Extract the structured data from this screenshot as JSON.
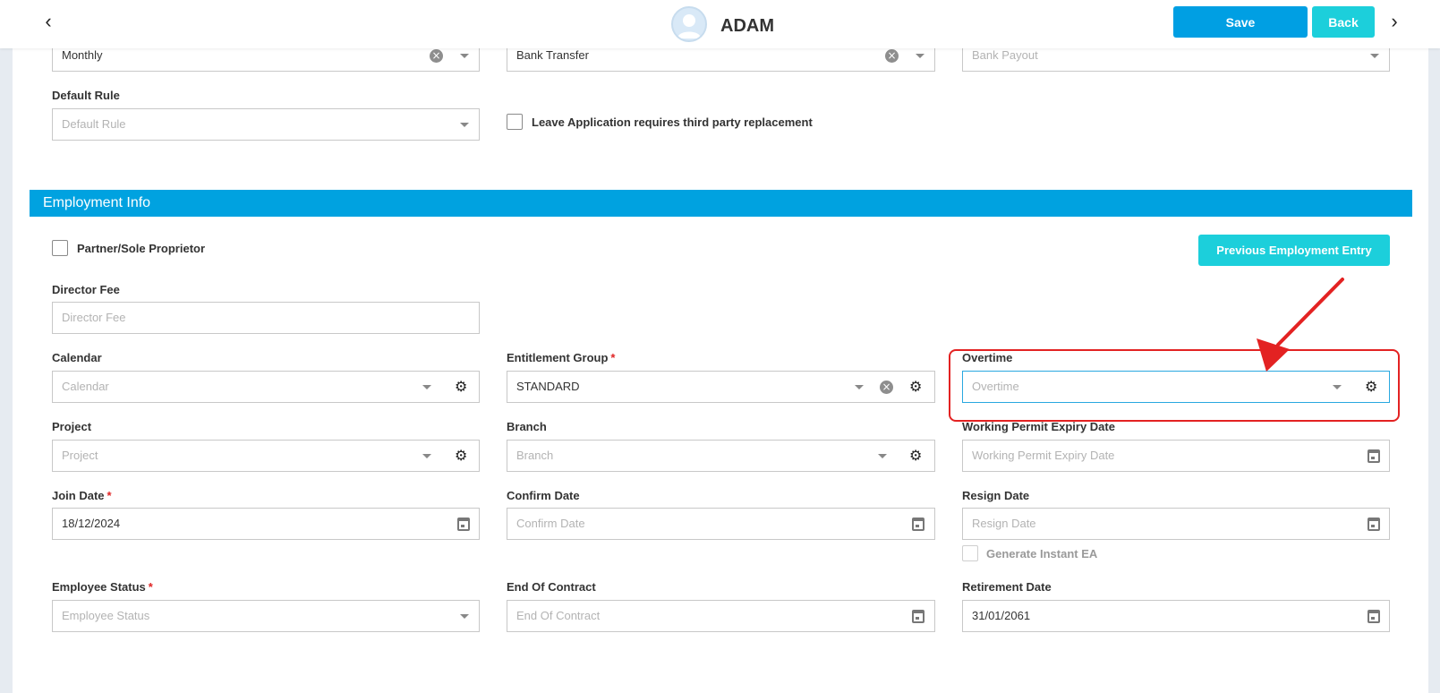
{
  "header": {
    "employee_name": "ADAM",
    "save_label": "Save",
    "back_label": "Back"
  },
  "top_fields": {
    "pay_frequency": {
      "value": "Monthly"
    },
    "payment_method": {
      "value": "Bank Transfer"
    },
    "bank_payout": {
      "placeholder": "Bank Payout"
    },
    "default_rule": {
      "label": "Default Rule",
      "placeholder": "Default Rule"
    },
    "leave_replacement": {
      "label": "Leave Application requires third party replacement",
      "checked": false
    }
  },
  "section": {
    "title": "Employment Info"
  },
  "employment": {
    "partner": {
      "label": "Partner/Sole Proprietor",
      "checked": false
    },
    "previous_employment_button": "Previous Employment Entry",
    "director_fee": {
      "label": "Director Fee",
      "placeholder": "Director Fee"
    },
    "calendar": {
      "label": "Calendar",
      "placeholder": "Calendar"
    },
    "entitlement_group": {
      "label": "Entitlement Group",
      "required_mark": "*",
      "value": "STANDARD"
    },
    "overtime": {
      "label": "Overtime",
      "placeholder": "Overtime"
    },
    "project": {
      "label": "Project",
      "placeholder": "Project"
    },
    "branch": {
      "label": "Branch",
      "placeholder": "Branch"
    },
    "working_permit": {
      "label": "Working Permit Expiry Date",
      "placeholder": "Working Permit Expiry Date"
    },
    "join_date": {
      "label": "Join Date",
      "required_mark": "*",
      "value": "18/12/2024"
    },
    "confirm_date": {
      "label": "Confirm Date",
      "placeholder": "Confirm Date"
    },
    "resign_date": {
      "label": "Resign Date",
      "placeholder": "Resign Date"
    },
    "generate_ea": {
      "label": "Generate Instant EA",
      "checked": false,
      "disabled": true
    },
    "employee_status": {
      "label": "Employee Status",
      "required_mark": "*",
      "placeholder": "Employee Status"
    },
    "end_of_contract": {
      "label": "End Of Contract",
      "placeholder": "End Of Contract"
    },
    "retirement_date": {
      "label": "Retirement Date",
      "value": "31/01/2061"
    }
  },
  "annotation": {
    "highlight_color": "#e32222"
  },
  "icons": [
    "chevron-left-icon",
    "chevron-right-icon",
    "avatar",
    "clear-icon",
    "dropdown-caret-icon",
    "gear-icon",
    "calendar-icon"
  ],
  "colors": {
    "primary": "#009fe3",
    "accent": "#1ccfdb",
    "section": "#00a2e0",
    "required": "#e02424"
  }
}
